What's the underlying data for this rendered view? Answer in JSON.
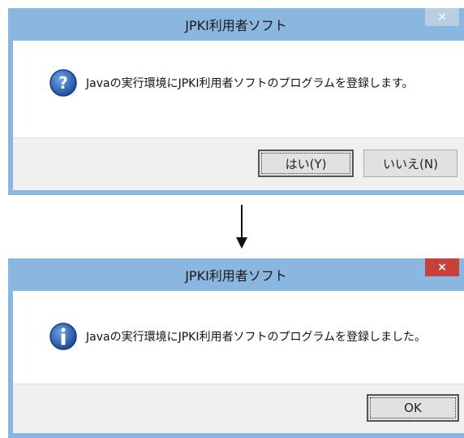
{
  "dialog1": {
    "title": "JPKI利用者ソフト",
    "close_label": "×",
    "icon": "question-icon",
    "message": "Javaの実行環境にJPKI利用者ソフトのプログラムを登録します。",
    "yes_label": "はい(Y)",
    "no_label": "いいえ(N)"
  },
  "arrow": {
    "icon": "down-arrow-icon"
  },
  "dialog2": {
    "title": "JPKI利用者ソフト",
    "close_label": "×",
    "icon": "info-icon",
    "message": "Javaの実行環境にJPKI利用者ソフトのプログラムを登録しました。",
    "ok_label": "OK"
  },
  "colors": {
    "frame": "#8ab7df",
    "close_active": "#c7403a",
    "question_icon": "#2f6fc8",
    "info_icon": "#2a63b8"
  }
}
